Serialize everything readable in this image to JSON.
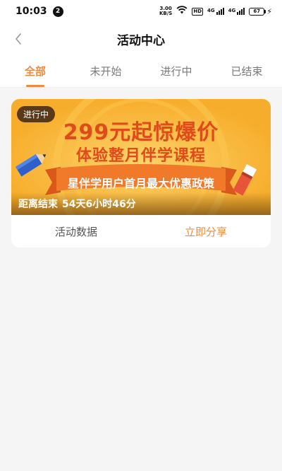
{
  "status_bar": {
    "time": "10:03",
    "notification_count": "2",
    "net_speed_value": "3.00",
    "net_speed_unit": "KB/S",
    "hd_label": "HD",
    "signal_1_label": "4G",
    "signal_2_label": "4G",
    "battery_level": "67"
  },
  "nav": {
    "title": "活动中心"
  },
  "tabs": [
    {
      "label": "全部",
      "active": true
    },
    {
      "label": "未开始",
      "active": false
    },
    {
      "label": "进行中",
      "active": false
    },
    {
      "label": "已结束",
      "active": false
    }
  ],
  "activity_card": {
    "status_badge": "进行中",
    "headline": "299元起惊爆价",
    "subheadline": "体验整月伴学课程",
    "ribbon_text": "星伴学用户首月最大优惠政策",
    "countdown_label": "距离结束",
    "countdown_value": "54天6小时46分",
    "data_button": "活动数据",
    "share_button": "立即分享"
  },
  "colors": {
    "accent": "#f08a3c",
    "banner_bg": "#f9b734",
    "headline_red": "#e04b1a",
    "ribbon_orange": "#f07a2a"
  }
}
